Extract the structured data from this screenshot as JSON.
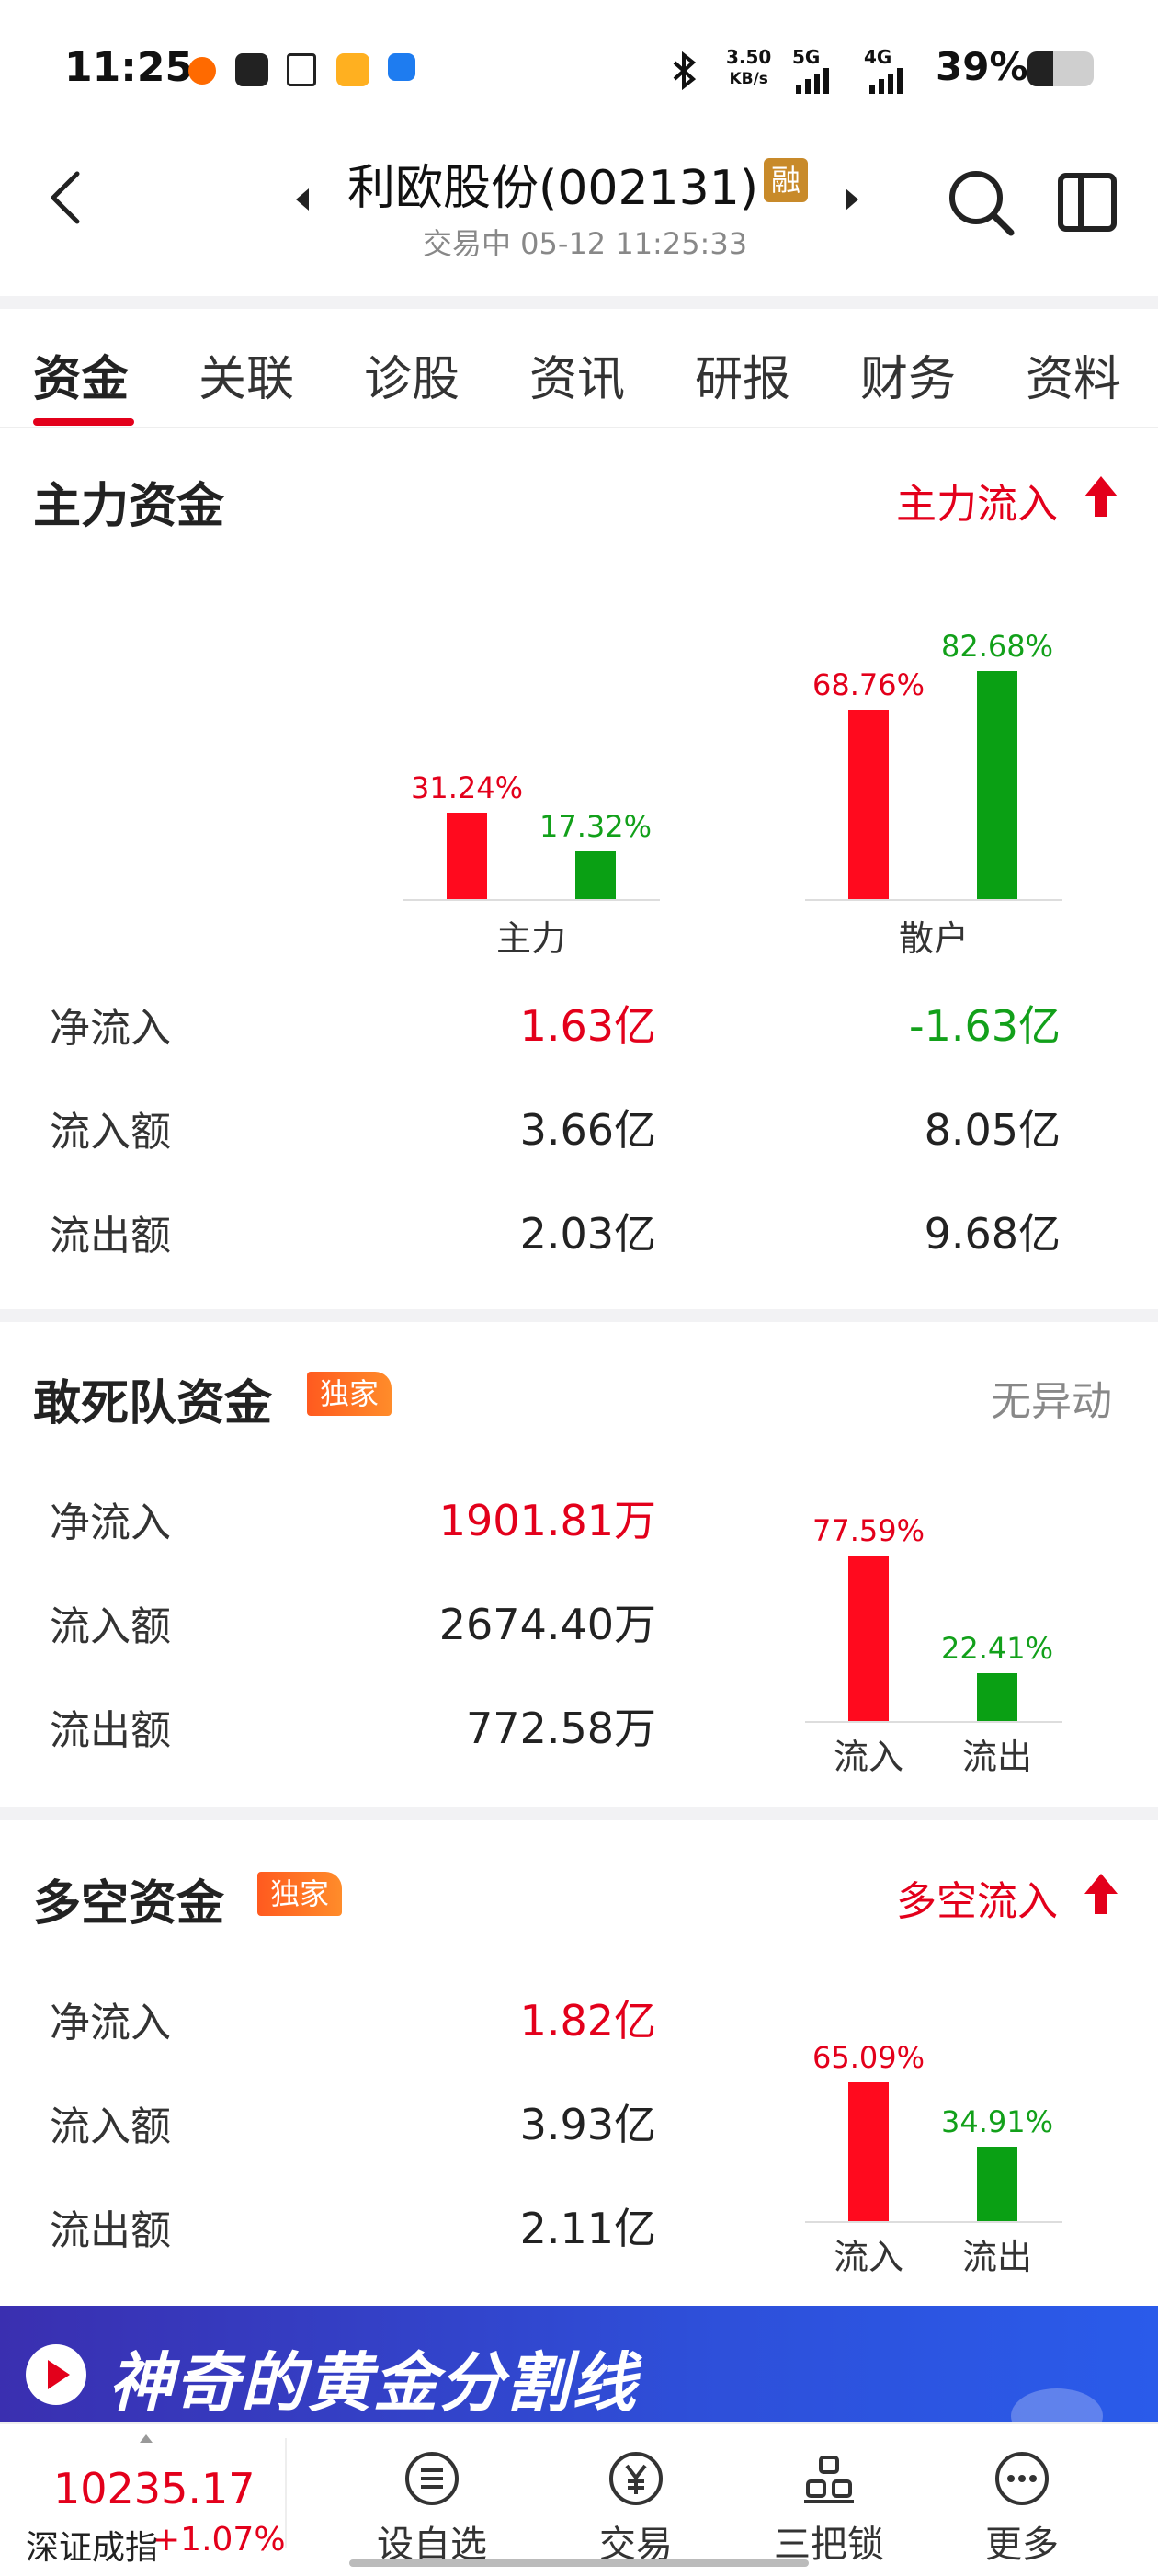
{
  "status_bar": {
    "time": "11:25",
    "net_speed_value": "3.50",
    "net_speed_unit": "KB/s",
    "signal_1": "5G",
    "signal_2": "4G",
    "battery": "39%",
    "battery_level": 0.39
  },
  "header": {
    "title": "利欧股份(002131)",
    "badge": "融",
    "subtitle": "交易中 05-12 11:25:33"
  },
  "tabs": [
    "资金",
    "关联",
    "诊股",
    "资讯",
    "研报",
    "财务",
    "资料"
  ],
  "main_funds": {
    "title": "主力资金",
    "status": "主力流入",
    "chart_data": {
      "type": "bar",
      "categories": [
        "主力",
        "散户"
      ],
      "series": [
        {
          "values": [
            31.24,
            68.76
          ],
          "labels": [
            "31.24%",
            "68.76%"
          ]
        },
        {
          "values": [
            17.32,
            82.68
          ],
          "labels": [
            "17.32%",
            "82.68%"
          ]
        }
      ],
      "colors": [
        "#ff0a1e",
        "#0aa014"
      ],
      "ylim": [
        0,
        100
      ]
    },
    "rows": [
      {
        "label": "净流入",
        "main": "1.63亿",
        "retail": "-1.63亿"
      },
      {
        "label": "流入额",
        "main": "3.66亿",
        "retail": "8.05亿"
      },
      {
        "label": "流出额",
        "main": "2.03亿",
        "retail": "9.68亿"
      }
    ]
  },
  "dare_funds": {
    "title": "敢死队资金",
    "badge": "独家",
    "status": "无异动",
    "rows": [
      {
        "label": "净流入",
        "value": "1901.81万"
      },
      {
        "label": "流入额",
        "value": "2674.40万"
      },
      {
        "label": "流出额",
        "value": "772.58万"
      }
    ],
    "chart_data": {
      "type": "bar",
      "categories": [
        "流入",
        "流出"
      ],
      "values": [
        77.59,
        22.41
      ],
      "labels": [
        "77.59%",
        "22.41%"
      ],
      "colors": [
        "#ff0a1e",
        "#0aa014"
      ],
      "ylim": [
        0,
        100
      ]
    }
  },
  "longshort_funds": {
    "title": "多空资金",
    "badge": "独家",
    "status": "多空流入",
    "rows": [
      {
        "label": "净流入",
        "value": "1.82亿"
      },
      {
        "label": "流入额",
        "value": "3.93亿"
      },
      {
        "label": "流出额",
        "value": "2.11亿"
      }
    ],
    "chart_data": {
      "type": "bar",
      "categories": [
        "流入",
        "流出"
      ],
      "values": [
        65.09,
        34.91
      ],
      "labels": [
        "65.09%",
        "34.91%"
      ],
      "colors": [
        "#ff0a1e",
        "#0aa014"
      ],
      "ylim": [
        0,
        100
      ]
    }
  },
  "ad": {
    "text": "神奇的黄金分割线"
  },
  "bottom_nav": {
    "index_value": "10235.17",
    "index_name": "深证成指",
    "index_change": "+1.07%",
    "items": [
      "设自选",
      "交易",
      "三把锁",
      "更多"
    ]
  }
}
